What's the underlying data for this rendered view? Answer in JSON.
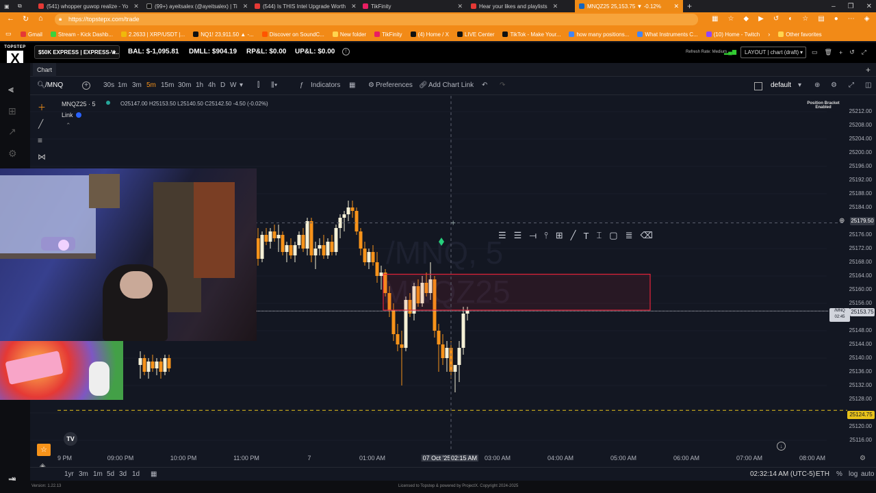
{
  "browser": {
    "tabs": [
      {
        "label": "(541) whopper guwop realize - Yo",
        "color": "#e53935"
      },
      {
        "label": "(99+) ayeitsalex (@ayeitsalex) | Ti",
        "color": "#111"
      },
      {
        "label": "(544) Is THIS Intel Upgrade Worth",
        "color": "#e53935"
      },
      {
        "label": "TikFinity",
        "color": "#e91e63"
      },
      {
        "label": "Hear your likes and playlists",
        "color": "#e53935"
      },
      {
        "label": "MNQZ25 25,153.75 ▼ -0.12%",
        "color": "#1565c0",
        "active": true
      }
    ],
    "url": "https://topstepx.com/trade",
    "bookmarks": [
      "Gmail",
      "Stream - Kick Dashb...",
      "2.2633 | XRP/USDT |...",
      "NQ1! 23,911.50 ▲ -...",
      "Discover on SoundC...",
      "New folder",
      "TikFinity",
      "(4) Home / X",
      "LIVE Center",
      "TikTok - Make Your...",
      "how many positions...",
      "What Instruments C...",
      "(10) Home - Twitch",
      "Other favorites"
    ]
  },
  "header": {
    "logo_top": "TOPSTEP",
    "logo_mark": "X",
    "account": "$50K EXPRESS | EXPRESS-V...",
    "balance": "BAL: $-1,095.81",
    "dmll": "DMLL: $904.19",
    "rpl": "RP&L: $0.00",
    "upl": "UP&L: $0.00",
    "refresh": "Refresh Rate: Medium",
    "layout": "LAYOUT | chart (draft)"
  },
  "tabstrip": {
    "tab": "Chart"
  },
  "toolbar": {
    "symbol": "/MNQ",
    "intervals": [
      "30s",
      "1m",
      "3m",
      "5m",
      "15m",
      "30m",
      "1h",
      "4h",
      "D",
      "W"
    ],
    "active_interval": "5m",
    "indicators": "Indicators",
    "preferences": "Preferences",
    "add_chart_link": "Add Chart Link",
    "template": "default"
  },
  "legend": {
    "title": "MNQZ25 · 5",
    "ohlc": "O25147.00 H25153.50 L25140.50 C25142.50 -4.50 (-0.02%)",
    "link": "Link"
  },
  "watermark": {
    "line1": "/MNQ, 5",
    "line2": "MNQZ25"
  },
  "position_bracket": {
    "line1": "Position Bracket",
    "line2": "Enabled"
  },
  "price_ticks": [
    "25212.00",
    "25208.00",
    "25204.00",
    "25200.00",
    "25196.00",
    "25192.00",
    "25188.00",
    "25184.00",
    "25179.50",
    "25176.00",
    "25172.00",
    "25168.00",
    "25164.00",
    "25160.00",
    "25156.00",
    "25153.75",
    "25148.00",
    "25144.00",
    "25140.00",
    "25136.00",
    "25132.00",
    "25128.00",
    "25124.75",
    "25120.00",
    "25116.00"
  ],
  "last_price_label": {
    "symbol": "/MNQ",
    "price": "25153.75",
    "countdown": "02:45"
  },
  "crosshair_price": "25179.50",
  "dashed_level": "25124.75",
  "time_ticks": [
    "9 PM",
    "09:00 PM",
    "10:00 PM",
    "11:00 PM",
    "7",
    "01:00 AM",
    "07 Oct '25",
    "02:15 AM",
    "03:00 AM",
    "04:00 AM",
    "05:00 AM",
    "06:00 AM",
    "07:00 AM",
    "08:00 AM"
  ],
  "bottombar": {
    "ranges": [
      "1yr",
      "3m",
      "1m",
      "5d",
      "3d",
      "1d"
    ],
    "clock": "02:32:14 AM (UTC-5)",
    "session": "ETH",
    "percent": "%",
    "log": "log",
    "auto": "auto"
  },
  "footer": {
    "version": "Version: 1.22.13",
    "license": "Licensed to Topstep & powered by ProjectX. Copyright 2024-2025"
  },
  "colors": {
    "up": "#f5f0d6",
    "down": "#f7931a",
    "zone": "#e5243b",
    "accent": "#f7931a",
    "level": "#e8c21a"
  },
  "chart_data": {
    "type": "candlestick",
    "symbol": "MNQZ25",
    "timeframe": "5",
    "ylim": [
      25114,
      25214
    ],
    "candles": [
      {
        "o": 25138,
        "h": 25142,
        "l": 25134,
        "c": 25140,
        "x": 205
      },
      {
        "o": 25140,
        "h": 25141,
        "l": 25135,
        "c": 25136,
        "x": 211
      },
      {
        "o": 25136,
        "h": 25140,
        "l": 25134,
        "c": 25139,
        "x": 217
      },
      {
        "o": 25139,
        "h": 25141,
        "l": 25136,
        "c": 25137,
        "x": 223
      },
      {
        "o": 25137,
        "h": 25140,
        "l": 25135,
        "c": 25139,
        "x": 229
      },
      {
        "o": 25139,
        "h": 25140,
        "l": 25134,
        "c": 25136,
        "x": 235
      },
      {
        "o": 25136,
        "h": 25141,
        "l": 25135,
        "c": 25140,
        "x": 241
      },
      {
        "o": 25140,
        "h": 25141,
        "l": 25136,
        "c": 25137,
        "x": 247
      },
      {
        "o": 25175,
        "h": 25178,
        "l": 25167,
        "c": 25169,
        "x": 377
      },
      {
        "o": 25169,
        "h": 25177,
        "l": 25168,
        "c": 25176,
        "x": 383
      },
      {
        "o": 25176,
        "h": 25178,
        "l": 25173,
        "c": 25174,
        "x": 389
      },
      {
        "o": 25174,
        "h": 25178,
        "l": 25172,
        "c": 25177,
        "x": 395
      },
      {
        "o": 25177,
        "h": 25179,
        "l": 25174,
        "c": 25175,
        "x": 401
      },
      {
        "o": 25175,
        "h": 25179,
        "l": 25171,
        "c": 25176,
        "x": 407
      },
      {
        "o": 25176,
        "h": 25177,
        "l": 25170,
        "c": 25171,
        "x": 413
      },
      {
        "o": 25171,
        "h": 25174,
        "l": 25168,
        "c": 25173,
        "x": 419
      },
      {
        "o": 25173,
        "h": 25175,
        "l": 25169,
        "c": 25170,
        "x": 425
      },
      {
        "o": 25170,
        "h": 25174,
        "l": 25168,
        "c": 25173,
        "x": 431
      },
      {
        "o": 25173,
        "h": 25177,
        "l": 25172,
        "c": 25176,
        "x": 437
      },
      {
        "o": 25176,
        "h": 25178,
        "l": 25171,
        "c": 25172,
        "x": 443
      },
      {
        "o": 25172,
        "h": 25181,
        "l": 25170,
        "c": 25180,
        "x": 449
      },
      {
        "o": 25180,
        "h": 25181,
        "l": 25168,
        "c": 25170,
        "x": 455
      },
      {
        "o": 25170,
        "h": 25174,
        "l": 25166,
        "c": 25172,
        "x": 461
      },
      {
        "o": 25172,
        "h": 25175,
        "l": 25170,
        "c": 25173,
        "x": 467
      },
      {
        "o": 25173,
        "h": 25176,
        "l": 25169,
        "c": 25170,
        "x": 473
      },
      {
        "o": 25170,
        "h": 25175,
        "l": 25169,
        "c": 25174,
        "x": 479
      },
      {
        "o": 25174,
        "h": 25176,
        "l": 25170,
        "c": 25171,
        "x": 485
      },
      {
        "o": 25171,
        "h": 25179,
        "l": 25170,
        "c": 25178,
        "x": 491
      },
      {
        "o": 25178,
        "h": 25182,
        "l": 25175,
        "c": 25181,
        "x": 497
      },
      {
        "o": 25181,
        "h": 25183,
        "l": 25177,
        "c": 25182,
        "x": 503
      },
      {
        "o": 25182,
        "h": 25186,
        "l": 25180,
        "c": 25184,
        "x": 509
      },
      {
        "o": 25184,
        "h": 25186,
        "l": 25181,
        "c": 25183,
        "x": 515
      },
      {
        "o": 25183,
        "h": 25184,
        "l": 25176,
        "c": 25177,
        "x": 521
      },
      {
        "o": 25177,
        "h": 25178,
        "l": 25170,
        "c": 25172,
        "x": 527
      },
      {
        "o": 25172,
        "h": 25174,
        "l": 25167,
        "c": 25168,
        "x": 533
      },
      {
        "o": 25168,
        "h": 25172,
        "l": 25166,
        "c": 25171,
        "x": 539
      },
      {
        "o": 25171,
        "h": 25173,
        "l": 25167,
        "c": 25168,
        "x": 545
      },
      {
        "o": 25168,
        "h": 25171,
        "l": 25162,
        "c": 25164,
        "x": 551
      },
      {
        "o": 25164,
        "h": 25167,
        "l": 25160,
        "c": 25165,
        "x": 557
      },
      {
        "o": 25165,
        "h": 25166,
        "l": 25158,
        "c": 25159,
        "x": 563
      },
      {
        "o": 25159,
        "h": 25161,
        "l": 25152,
        "c": 25154,
        "x": 569
      },
      {
        "o": 25154,
        "h": 25156,
        "l": 25145,
        "c": 25147,
        "x": 575
      },
      {
        "o": 25147,
        "h": 25150,
        "l": 25142,
        "c": 25144,
        "x": 581
      },
      {
        "o": 25144,
        "h": 25148,
        "l": 25132,
        "c": 25143,
        "x": 587
      },
      {
        "o": 25143,
        "h": 25158,
        "l": 25142,
        "c": 25157,
        "x": 593
      },
      {
        "o": 25157,
        "h": 25159,
        "l": 25152,
        "c": 25153,
        "x": 599
      },
      {
        "o": 25153,
        "h": 25162,
        "l": 25151,
        "c": 25161,
        "x": 605
      },
      {
        "o": 25161,
        "h": 25163,
        "l": 25155,
        "c": 25156,
        "x": 611
      },
      {
        "o": 25156,
        "h": 25164,
        "l": 25155,
        "c": 25162,
        "x": 617
      },
      {
        "o": 25162,
        "h": 25165,
        "l": 25158,
        "c": 25159,
        "x": 623
      },
      {
        "o": 25159,
        "h": 25168,
        "l": 25157,
        "c": 25163,
        "x": 629
      },
      {
        "o": 25163,
        "h": 25164,
        "l": 25146,
        "c": 25148,
        "x": 635
      },
      {
        "o": 25148,
        "h": 25150,
        "l": 25136,
        "c": 25144,
        "x": 641
      },
      {
        "o": 25144,
        "h": 25147,
        "l": 25138,
        "c": 25140,
        "x": 647
      },
      {
        "o": 25140,
        "h": 25145,
        "l": 25136,
        "c": 25143,
        "x": 653
      },
      {
        "o": 25143,
        "h": 25145,
        "l": 25134,
        "c": 25136,
        "x": 659
      },
      {
        "o": 25136,
        "h": 25138,
        "l": 25130,
        "c": 25138,
        "x": 665
      },
      {
        "o": 25138,
        "h": 25145,
        "l": 25133,
        "c": 25143,
        "x": 671
      },
      {
        "o": 25143,
        "h": 25155,
        "l": 25141,
        "c": 25153,
        "x": 677
      },
      {
        "o": 25153,
        "h": 25155,
        "l": 25151,
        "c": 25154,
        "x": 683
      }
    ]
  }
}
